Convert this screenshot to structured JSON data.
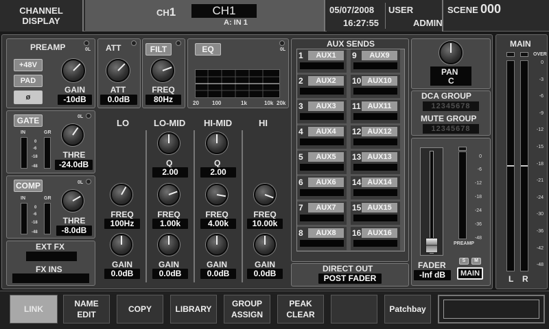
{
  "header": {
    "title_line1": "CHANNEL",
    "title_line2": "DISPLAY",
    "ch_prefix": "CH",
    "ch_num": "1",
    "ch_name": "CH1",
    "input": "A: IN 1",
    "date": "05/07/2008",
    "time": "16:27:55",
    "user_label": "USER",
    "user_name": "ADMIN",
    "scene_label": "SCENE",
    "scene_num": "000"
  },
  "preamp": {
    "title": "PREAMP",
    "ol": "0L",
    "btn_48v": "+48V",
    "btn_pad": "PAD",
    "btn_phase": "ø",
    "gain_label": "GAIN",
    "gain_value": "-10dB"
  },
  "att": {
    "title": "ATT",
    "label": "ATT",
    "value": "0.0dB"
  },
  "filt": {
    "title": "FILT",
    "label": "FREQ",
    "value": "80Hz"
  },
  "eq": {
    "title": "EQ",
    "axis": [
      "20",
      "100",
      "1k",
      "10k",
      "20k"
    ],
    "bands": [
      {
        "name": "LO",
        "freq_label": "FREQ",
        "freq": "100Hz",
        "gain_label": "GAIN",
        "gain": "0.0dB"
      },
      {
        "name": "LO-MID",
        "q_label": "Q",
        "q": "2.00",
        "freq_label": "FREQ",
        "freq": "1.00k",
        "gain_label": "GAIN",
        "gain": "0.0dB"
      },
      {
        "name": "HI-MID",
        "q_label": "Q",
        "q": "2.00",
        "freq_label": "FREQ",
        "freq": "4.00k",
        "gain_label": "GAIN",
        "gain": "0.0dB"
      },
      {
        "name": "HI",
        "freq_label": "FREQ",
        "freq": "10.00k",
        "gain_label": "GAIN",
        "gain": "0.0dB"
      }
    ]
  },
  "gate": {
    "title": "GATE",
    "ol": "0L",
    "in": "IN",
    "gr": "GR",
    "label": "THRE",
    "value": "-24.0dB"
  },
  "comp": {
    "title": "COMP",
    "ol": "0L",
    "in": "IN",
    "gr": "GR",
    "label": "THRE",
    "value": "-8.0dB"
  },
  "dyn_scale": [
    "0",
    "-6",
    "-18",
    "-48"
  ],
  "ext_fx": "EXT FX",
  "fx_ins": "FX INS",
  "aux": {
    "title": "AUX SENDS",
    "items": [
      {
        "num": "1",
        "name": "AUX1"
      },
      {
        "num": "9",
        "name": "AUX9"
      },
      {
        "num": "2",
        "name": "AUX2"
      },
      {
        "num": "10",
        "name": "AUX10"
      },
      {
        "num": "3",
        "name": "AUX3"
      },
      {
        "num": "11",
        "name": "AUX11"
      },
      {
        "num": "4",
        "name": "AUX4"
      },
      {
        "num": "12",
        "name": "AUX12"
      },
      {
        "num": "5",
        "name": "AUX5"
      },
      {
        "num": "13",
        "name": "AUX13"
      },
      {
        "num": "6",
        "name": "AUX6"
      },
      {
        "num": "14",
        "name": "AUX14"
      },
      {
        "num": "7",
        "name": "AUX7"
      },
      {
        "num": "15",
        "name": "AUX15"
      },
      {
        "num": "8",
        "name": "AUX8"
      },
      {
        "num": "16",
        "name": "AUX16"
      }
    ]
  },
  "direct_out": {
    "title": "DIRECT OUT",
    "value": "POST FADER"
  },
  "pan": {
    "label": "PAN",
    "value": "C"
  },
  "dca": {
    "title": "DCA GROUP",
    "digits": "12345678"
  },
  "mute": {
    "title": "MUTE GROUP",
    "digits": "12345678"
  },
  "fader": {
    "label": "FADER",
    "value": "-Inf dB",
    "scale": [
      "0",
      "-6",
      "-12",
      "-18",
      "-24",
      "-36",
      "-48"
    ],
    "preamp": "PREAMP",
    "s": "S",
    "m": "M",
    "main": "MAIN",
    "level": 0.1
  },
  "main_meter": {
    "title": "MAIN",
    "over": "OVER",
    "scale": [
      "0",
      "-3",
      "-6",
      "-9",
      "-12",
      "-15",
      "-18",
      "-21",
      "-24",
      "-30",
      "-36",
      "-42",
      "-48"
    ],
    "l": "L",
    "r": "R"
  },
  "footer": {
    "link": "LINK",
    "name_edit_1": "NAME",
    "name_edit_2": "EDIT",
    "copy": "COPY",
    "library": "LIBRARY",
    "group_1": "GROUP",
    "group_2": "ASSIGN",
    "peak_1": "PEAK",
    "peak_2": "CLEAR",
    "blank": "",
    "patchbay": "Patchbay"
  }
}
